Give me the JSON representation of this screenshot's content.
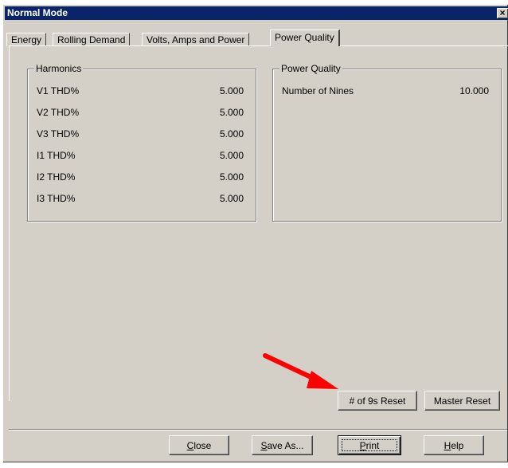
{
  "window": {
    "title": "Normal Mode",
    "close_glyph": "×"
  },
  "tabs": [
    {
      "label": "Energy"
    },
    {
      "label": "Rolling Demand"
    },
    {
      "label": "Volts, Amps and Power"
    },
    {
      "label": "Power Quality"
    }
  ],
  "harmonics": {
    "title": "Harmonics",
    "rows": [
      {
        "label": "V1 THD%",
        "value": "5.000"
      },
      {
        "label": "V2 THD%",
        "value": "5.000"
      },
      {
        "label": "V3 THD%",
        "value": "5.000"
      },
      {
        "label": "I1 THD%",
        "value": "5.000"
      },
      {
        "label": "I2 THD%",
        "value": "5.000"
      },
      {
        "label": "I3 THD%",
        "value": "5.000"
      }
    ]
  },
  "power_quality": {
    "title": "Power Quality",
    "rows": [
      {
        "label": "Number of Nines",
        "value": "10.000"
      }
    ]
  },
  "buttons": {
    "nines_reset": "# of 9s Reset",
    "master_reset": "Master Reset",
    "close_m": "C",
    "close_rest": "lose",
    "save_m": "S",
    "save_rest": "ave As...",
    "print_m": "P",
    "print_rest": "rint",
    "help_m": "H",
    "help_rest": "elp"
  },
  "colors": {
    "titlebar": "#0a246a",
    "face": "#d4d0c8",
    "arrow": "#ff0000"
  },
  "icons": {
    "annotation": "red-arrow-icon",
    "close": "close-icon"
  }
}
